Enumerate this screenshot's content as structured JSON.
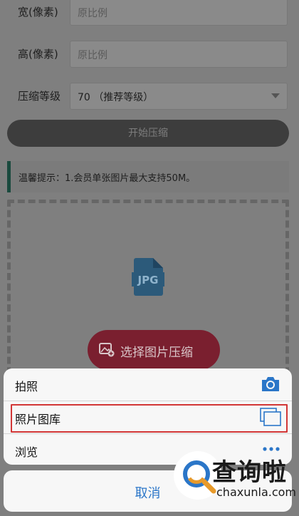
{
  "form": {
    "width": {
      "label": "宽(像素)",
      "placeholder": "原比例"
    },
    "height": {
      "label": "高(像素)",
      "placeholder": "原比例"
    },
    "compression": {
      "label": "压缩等级",
      "selected": "70 （推荐等级）"
    },
    "start_button": "开始压缩"
  },
  "tip": "温馨提示：1.会员单张图片最大支持50M。",
  "upload": {
    "file_type": "JPG",
    "choose_button": "选择图片压缩"
  },
  "action_sheet": {
    "items": [
      {
        "label": "拍照",
        "icon": "camera-icon"
      },
      {
        "label": "照片图库",
        "icon": "gallery-icon"
      },
      {
        "label": "浏览",
        "icon": "more-icon"
      }
    ],
    "cancel": "取消",
    "accent": "#2b76c8",
    "highlight_color": "#d23636"
  },
  "watermark": {
    "name": "查询啦",
    "domain": "chaxunla.com"
  }
}
